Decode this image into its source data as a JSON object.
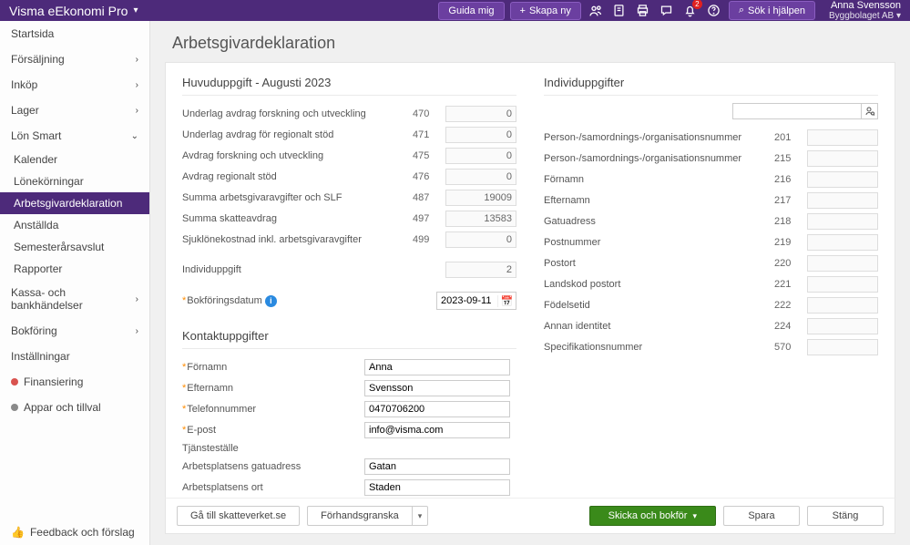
{
  "app": {
    "title": "Visma eEkonomi Pro"
  },
  "topbar": {
    "guide": "Guida mig",
    "create": "Skapa ny",
    "search": "Sök i hjälpen",
    "notif_count": "2"
  },
  "user": {
    "name": "Anna Svensson",
    "company": "Byggbolaget AB"
  },
  "sidebar": {
    "startsida": "Startsida",
    "forsaljning": "Försäljning",
    "inkop": "Inköp",
    "lager": "Lager",
    "lon": "Lön Smart",
    "sub": {
      "kalender": "Kalender",
      "lonekorningar": "Lönekörningar",
      "arbetsgivardeklaration": "Arbetsgivardeklaration",
      "anstallda": "Anställda",
      "semesterarsavslut": "Semesterårsavslut",
      "rapporter": "Rapporter"
    },
    "kassa": "Kassa- och bankhändelser",
    "bokforing": "Bokföring",
    "installningar": "Inställningar",
    "finansiering": "Finansiering",
    "appar": "Appar och tillval",
    "feedback": "Feedback och förslag"
  },
  "status_colors": {
    "finansiering": "#d9534f",
    "appar": "#8a8a8a"
  },
  "page": {
    "title": "Arbetsgivardeklaration"
  },
  "huvud": {
    "title": "Huvuduppgift - Augusti 2023",
    "rows": [
      {
        "label": "Underlag avdrag forskning och utveckling",
        "code": "470",
        "value": "0"
      },
      {
        "label": "Underlag avdrag för regionalt stöd",
        "code": "471",
        "value": "0"
      },
      {
        "label": "Avdrag forskning och utveckling",
        "code": "475",
        "value": "0"
      },
      {
        "label": "Avdrag regionalt stöd",
        "code": "476",
        "value": "0"
      },
      {
        "label": "Summa arbetsgivaravgifter och SLF",
        "code": "487",
        "value": "19009"
      },
      {
        "label": "Summa skatteavdrag",
        "code": "497",
        "value": "13583"
      },
      {
        "label": "Sjuklönekostnad inkl. arbetsgivaravgifter",
        "code": "499",
        "value": "0"
      }
    ],
    "individ_label": "Individuppgift",
    "individ_value": "2",
    "bokforing_label": "Bokföringsdatum",
    "bokforing_value": "2023-09-11"
  },
  "kontakt": {
    "title": "Kontaktuppgifter",
    "fields": [
      {
        "label": "Förnamn",
        "value": "Anna",
        "req": true
      },
      {
        "label": "Efternamn",
        "value": "Svensson",
        "req": true
      },
      {
        "label": "Telefonnummer",
        "value": "0470706200",
        "req": true
      },
      {
        "label": "E-post",
        "value": "info@visma.com",
        "req": true
      },
      {
        "label": "Tjänsteställe",
        "value": "",
        "req": false
      },
      {
        "label": "Arbetsplatsens gatuadress",
        "value": "Gatan",
        "req": false
      },
      {
        "label": "Arbetsplatsens ort",
        "value": "Staden",
        "req": false
      }
    ]
  },
  "indiv": {
    "title": "Individuppgifter",
    "rows": [
      {
        "label": "Person-/samordnings-/organisationsnummer",
        "code": "201"
      },
      {
        "label": "Person-/samordnings-/organisationsnummer",
        "code": "215"
      },
      {
        "label": "Förnamn",
        "code": "216"
      },
      {
        "label": "Efternamn",
        "code": "217"
      },
      {
        "label": "Gatuadress",
        "code": "218"
      },
      {
        "label": "Postnummer",
        "code": "219"
      },
      {
        "label": "Postort",
        "code": "220"
      },
      {
        "label": "Landskod postort",
        "code": "221"
      },
      {
        "label": "Födelsetid",
        "code": "222"
      },
      {
        "label": "Annan identitet",
        "code": "224"
      },
      {
        "label": "Specifikationsnummer",
        "code": "570"
      }
    ]
  },
  "footer": {
    "skatteverket": "Gå till skatteverket.se",
    "preview": "Förhandsgranska",
    "send": "Skicka och bokför",
    "save": "Spara",
    "close": "Stäng"
  }
}
